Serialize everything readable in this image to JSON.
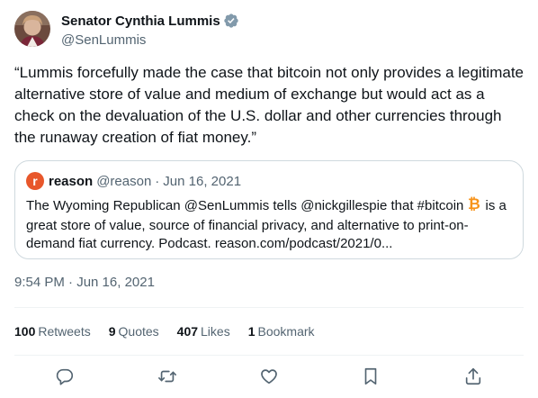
{
  "author": {
    "display_name": "Senator Cynthia Lummis",
    "handle": "@SenLummis",
    "verified": true,
    "avatar_icon": "profile-photo"
  },
  "tweet": {
    "text": "“Lummis forcefully made the case that bitcoin not only provides a legitimate alternative store of value and medium of exchange but would act as a check on the devaluation of the U.S. dollar and other currencies through the runaway creation of fiat money.”",
    "timestamp": "9:54 PM · Jun 16, 2021"
  },
  "quoted_tweet": {
    "avatar_letter": "r",
    "avatar_color": "#e8572b",
    "display_name": "reason",
    "handle": "@reason",
    "separator": "·",
    "date": "Jun 16, 2021",
    "text_before_icon": "The Wyoming Republican @SenLummis tells @nickgillespie that #bitcoin",
    "inline_icon": "bitcoin-icon",
    "text_after_icon": " is a great store of value, source of financial privacy, and alternative to print-on-demand fiat currency. Podcast. reason.com/podcast/2021/0..."
  },
  "stats": [
    {
      "count": "100",
      "label": "Retweets"
    },
    {
      "count": "9",
      "label": "Quotes"
    },
    {
      "count": "407",
      "label": "Likes"
    },
    {
      "count": "1",
      "label": "Bookmark"
    }
  ],
  "actions": [
    "reply-icon",
    "retweet-icon",
    "like-icon",
    "bookmark-icon",
    "share-icon"
  ],
  "colors": {
    "text_primary": "#0f1419",
    "text_secondary": "#536471",
    "verified": "#829aab",
    "border": "#cfd9de",
    "bitcoin": "#f7931a"
  }
}
